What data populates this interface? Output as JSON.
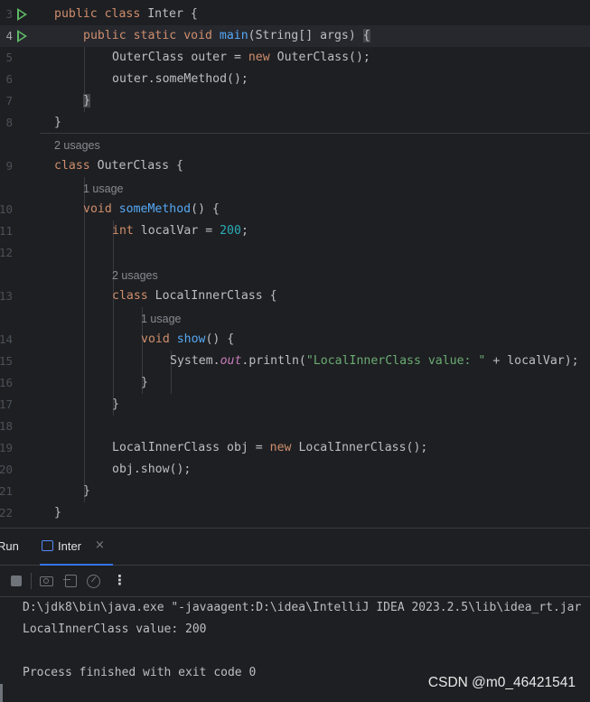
{
  "editor": {
    "lines": [
      {
        "n": "3"
      },
      {
        "n": "4"
      },
      {
        "n": "5"
      },
      {
        "n": "6"
      },
      {
        "n": "7"
      },
      {
        "n": "8"
      },
      {
        "n": ""
      },
      {
        "n": "9"
      },
      {
        "n": ""
      },
      {
        "n": "10"
      },
      {
        "n": "11"
      },
      {
        "n": "12"
      },
      {
        "n": ""
      },
      {
        "n": "13"
      },
      {
        "n": ""
      },
      {
        "n": "14"
      },
      {
        "n": "15"
      },
      {
        "n": "16"
      },
      {
        "n": "17"
      },
      {
        "n": "18"
      },
      {
        "n": "19"
      },
      {
        "n": "20"
      },
      {
        "n": "21"
      },
      {
        "n": "22"
      }
    ],
    "tok": {
      "public": "public",
      "class": "class",
      "static": "static",
      "void": "void",
      "new": "new",
      "int": "int",
      "Inter": " Inter {",
      "main": "main",
      "main_args": "(String[] args) ",
      "brace_open": "{",
      "brace_close": "}",
      "outer_decl": "OuterClass outer = ",
      "outer_ctor": " OuterClass();",
      "outer_call": "outer.someMethod();",
      "OuterClass": " OuterClass {",
      "someMethod": "someMethod",
      "parens_brace": "() {",
      "localVar": " localVar = ",
      "n200": "200",
      "semi": ";",
      "LocalInnerClass": " LocalInnerClass {",
      "show": "show",
      "system": "System.",
      "out": "out",
      "println": ".println(",
      "str": "\"LocalInnerClass value: \"",
      "concat": " + localVar);",
      "obj_decl": "LocalInnerClass obj = ",
      "obj_ctor": " LocalInnerClass();",
      "obj_show": "obj.show();"
    },
    "hints": {
      "two_usages": "2 usages",
      "one_usage": "1 usage"
    }
  },
  "run_panel": {
    "title": "Run",
    "tab_label": "Inter",
    "tab_close": "×",
    "more": "⋮",
    "icons": [
      "stop-icon",
      "camera-icon",
      "import-icon",
      "gauge-icon",
      "more-icon"
    ]
  },
  "console": {
    "lines": [
      "D:\\jdk8\\bin\\java.exe \"-javaagent:D:\\idea\\IntelliJ IDEA 2023.2.5\\lib\\idea_rt.jar",
      "LocalInnerClass value: 200",
      "",
      "Process finished with exit code 0"
    ]
  },
  "watermark": "CSDN @m0_46421541",
  "colors": {
    "background": "#1e1f22",
    "keyword": "#cf8e6d",
    "function": "#56a8f5",
    "number": "#2aacb8",
    "string": "#6aab73",
    "static_field": "#c77dbb",
    "run_icon": "#5fb865",
    "accent": "#3574f0"
  }
}
